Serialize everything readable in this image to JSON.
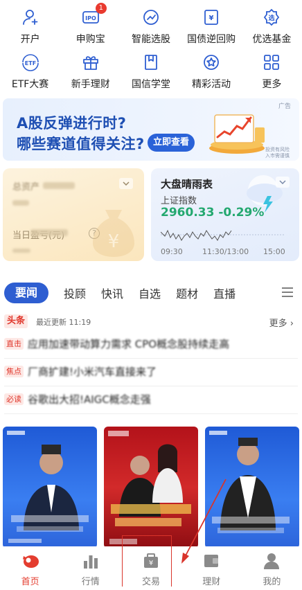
{
  "grid": [
    {
      "label": "开户",
      "icon": "person-add-icon"
    },
    {
      "label": "申购宝",
      "icon": "ipo-icon",
      "icon_text": "IPO",
      "badge": "1"
    },
    {
      "label": "智能选股",
      "icon": "gauge-icon"
    },
    {
      "label": "国债逆回购",
      "icon": "bond-icon",
      "icon_text": "¥"
    },
    {
      "label": "优选基金",
      "icon": "fund-icon",
      "icon_text": "选"
    },
    {
      "label": "ETF大赛",
      "icon": "etf-icon",
      "icon_text": "ETF"
    },
    {
      "label": "新手理财",
      "icon": "gift-icon"
    },
    {
      "label": "国信学堂",
      "icon": "book-icon"
    },
    {
      "label": "精彩活动",
      "icon": "star-icon"
    },
    {
      "label": "更多",
      "icon": "grid-icon"
    }
  ],
  "banner": {
    "line1": "A股反弹进行时?",
    "line2": "哪些赛道值得关注?",
    "cta": "立即查看",
    "ad_label": "广告",
    "note_line1": "投资有风险",
    "note_line2": "入市需谨慎"
  },
  "asset_card": {
    "total_label": "总资产",
    "today_label": "当日盈亏(元)",
    "help": "?"
  },
  "market_card": {
    "title": "大盘晴雨表",
    "index_name": "上证指数",
    "index_value": "2960.33",
    "index_change": "-0.29%",
    "times": [
      "09:30",
      "11:30/13:00",
      "15:00"
    ]
  },
  "tabs": [
    "要闻",
    "投顾",
    "快讯",
    "自选",
    "题材",
    "直播"
  ],
  "headline": {
    "tag": "头条",
    "updated": "最近更新 11:19",
    "more": "更多"
  },
  "news": [
    {
      "tag": "直击",
      "title": "应用加速带动算力需求 CPO概念股持续走高"
    },
    {
      "tag": "焦点",
      "title": "厂商扩建!小米汽车直接来了"
    },
    {
      "tag": "必读",
      "title": "谷歌出大招!AIGC概念走强"
    }
  ],
  "nav": [
    {
      "label": "首页",
      "icon": "home-icon",
      "active": true
    },
    {
      "label": "行情",
      "icon": "chart-bars-icon",
      "active": false
    },
    {
      "label": "交易",
      "icon": "trade-icon",
      "active": false
    },
    {
      "label": "理财",
      "icon": "wallet-icon",
      "active": false
    },
    {
      "label": "我的",
      "icon": "profile-icon",
      "active": false
    }
  ],
  "colors": {
    "accent_blue": "#2e5ed1",
    "brand_red": "#e43d2f",
    "rise_green": "#23a86f"
  }
}
